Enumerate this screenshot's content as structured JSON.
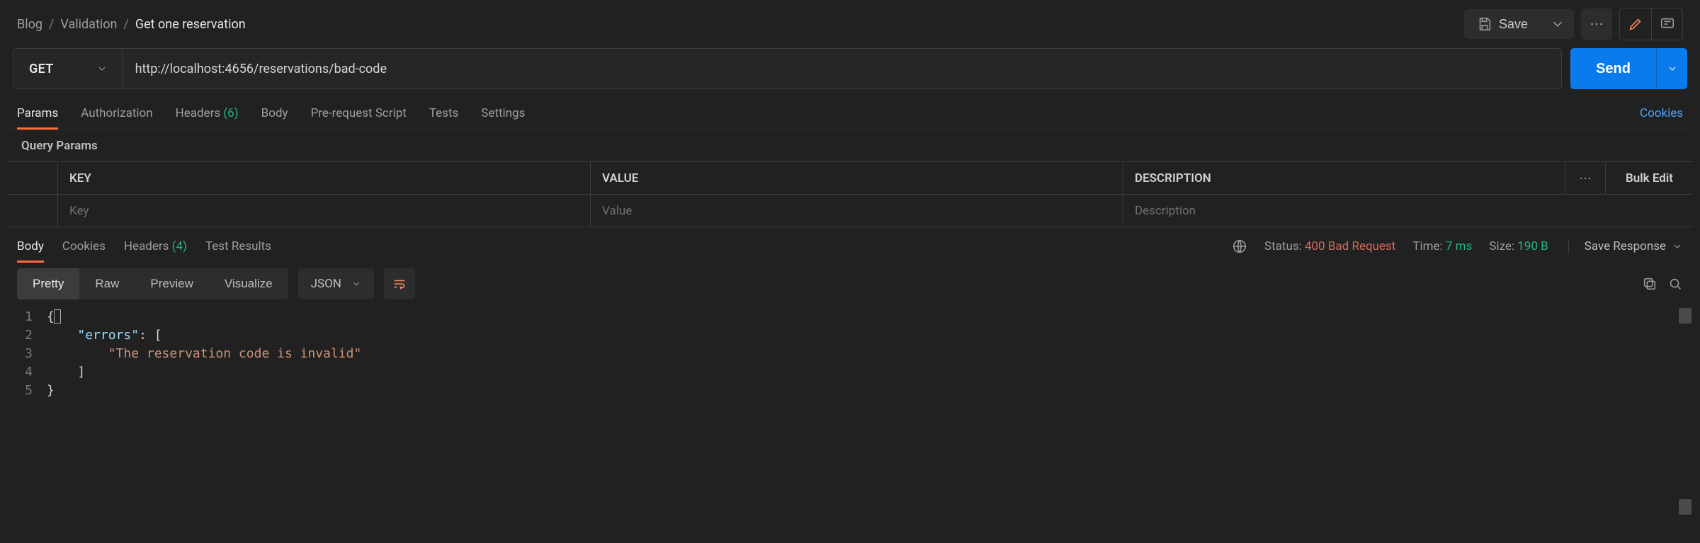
{
  "breadcrumb": {
    "a": "Blog",
    "b": "Validation",
    "c": "Get one reservation"
  },
  "top": {
    "save": "Save"
  },
  "request": {
    "method": "GET",
    "url": "http://localhost:4656/reservations/bad-code",
    "send": "Send"
  },
  "req_tabs": {
    "params": "Params",
    "authorization": "Authorization",
    "headers": "Headers",
    "headers_count": "(6)",
    "body": "Body",
    "prerequest": "Pre-request Script",
    "tests": "Tests",
    "settings": "Settings",
    "cookies": "Cookies"
  },
  "query_params": {
    "section": "Query Params",
    "headers": {
      "key": "KEY",
      "value": "VALUE",
      "desc": "DESCRIPTION"
    },
    "bulk": "Bulk Edit",
    "placeholders": {
      "key": "Key",
      "value": "Value",
      "desc": "Description"
    }
  },
  "resp_tabs": {
    "body": "Body",
    "cookies": "Cookies",
    "headers": "Headers",
    "headers_count": "(4)",
    "test_results": "Test Results"
  },
  "status": {
    "status_label": "Status:",
    "code_text": "400",
    "code_msg": "Bad Request",
    "time_label": "Time:",
    "time_value": "7 ms",
    "size_label": "Size:",
    "size_value": "190 B",
    "save_response": "Save Response"
  },
  "viewer": {
    "pretty": "Pretty",
    "raw": "Raw",
    "preview": "Preview",
    "visualize": "Visualize",
    "format": "JSON"
  },
  "body_json": {
    "lines": [
      "1",
      "2",
      "3",
      "4",
      "5"
    ],
    "key_errors": "\"errors\"",
    "string_msg": "\"The reservation code is invalid\""
  }
}
